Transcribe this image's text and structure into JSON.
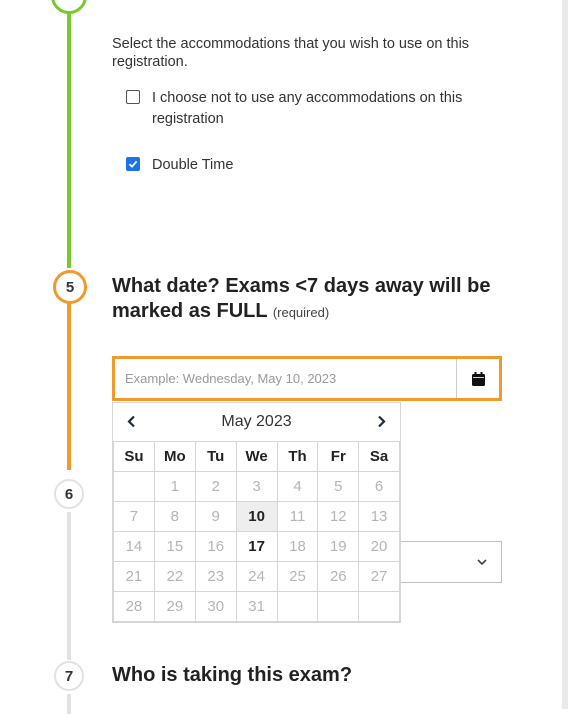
{
  "colors": {
    "accent": "#f2992e",
    "done": "#7ac92c",
    "pending": "#e2e2e2",
    "checkbox": "#1a73e8"
  },
  "accommodations": {
    "intro": "Select the accommodations that you wish to use on this registration.",
    "options": [
      {
        "label": "I choose not to use any accommodations on this registration",
        "checked": false
      },
      {
        "label": "Double Time",
        "checked": true
      }
    ]
  },
  "steps": {
    "five": {
      "number": "5",
      "title": "What date? Exams <7 days away will be marked as FULL",
      "required": "(required)"
    },
    "six": {
      "number": "6"
    },
    "seven": {
      "number": "7",
      "title": "Who is taking this exam?"
    }
  },
  "date_field": {
    "placeholder": "Example: Wednesday, May 10, 2023",
    "button_icon": "calendar-icon"
  },
  "calendar": {
    "month_label": "May 2023",
    "prev_icon": "chevron-left-icon",
    "next_icon": "chevron-right-icon",
    "weekdays": [
      "Su",
      "Mo",
      "Tu",
      "We",
      "Th",
      "Fr",
      "Sa"
    ],
    "weeks": [
      [
        "",
        "1",
        "2",
        "3",
        "4",
        "5",
        "6"
      ],
      [
        "7",
        "8",
        "9",
        "10",
        "11",
        "12",
        "13"
      ],
      [
        "14",
        "15",
        "16",
        "17",
        "18",
        "19",
        "20"
      ],
      [
        "21",
        "22",
        "23",
        "24",
        "25",
        "26",
        "27"
      ],
      [
        "28",
        "29",
        "30",
        "31",
        "",
        "",
        ""
      ]
    ],
    "today": "10",
    "available": [
      "17"
    ]
  }
}
